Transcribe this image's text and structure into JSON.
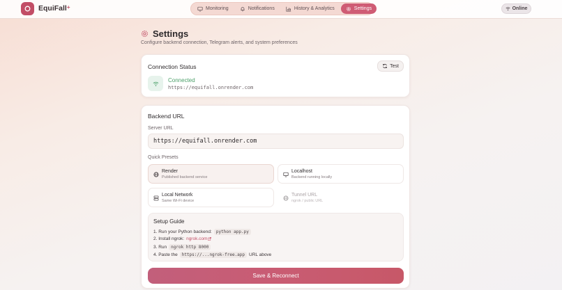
{
  "app": {
    "brand": "EquiFall",
    "brand_suffix": "+"
  },
  "nav": {
    "tabs": [
      {
        "label": "Monitoring",
        "icon": "monitor-icon"
      },
      {
        "label": "Notifications",
        "icon": "bell-icon"
      },
      {
        "label": "History & Analytics",
        "icon": "chart-icon"
      },
      {
        "label": "Settings",
        "icon": "gear-icon",
        "active": true
      }
    ],
    "status": "Online"
  },
  "page": {
    "title": "Settings",
    "subtitle": "Configure backend connection, Telegram alerts, and system preferences"
  },
  "connection": {
    "title": "Connection Status",
    "test_label": "Test",
    "status": "Connected",
    "url": "https://equifall.onrender.com"
  },
  "backend": {
    "title": "Backend URL",
    "server_url_label": "Server URL",
    "server_url_value": "https://equifall.onrender.com",
    "presets_label": "Quick Presets",
    "presets": [
      {
        "name": "Render",
        "desc": "Published backend service",
        "icon": "globe-icon",
        "selected": true
      },
      {
        "name": "Localhost",
        "desc": "Backend running locally",
        "icon": "monitor-icon"
      },
      {
        "name": "Local Network",
        "desc": "Same Wi-Fi device",
        "icon": "server-icon"
      },
      {
        "name": "Tunnel URL",
        "desc": "ngrok / public URL",
        "icon": "globe-icon",
        "disabled": true
      }
    ],
    "guide": {
      "title": "Setup Guide",
      "step1_text": "1. Run your Python backend:",
      "step1_code": "python app.py",
      "step2_text": "2. Install ngrok:",
      "step2_link": "ngrok.com",
      "step3_text": "3. Run",
      "step3_code": "ngrok http 8000",
      "step4_text": "4. Paste the",
      "step4_code": "https://...ngrok-free.app",
      "step4_suffix": "URL above"
    },
    "save_label": "Save & Reconnect"
  },
  "colors": {
    "accent": "#c24e66",
    "success": "#4a9f68"
  }
}
